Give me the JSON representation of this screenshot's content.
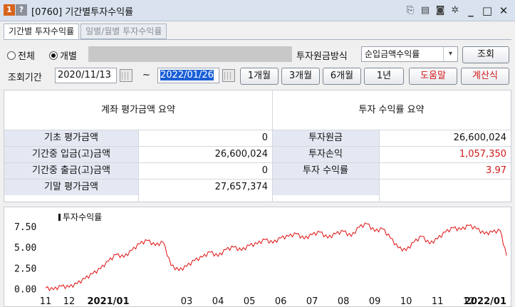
{
  "window": {
    "title": "[0760] 기간별투자수익률",
    "badge_num": "1",
    "badge_q": "?"
  },
  "tabs": [
    {
      "label": "기간별 투자수익률",
      "active": true
    },
    {
      "label": "일별/월별 투자수익률",
      "active": false
    }
  ],
  "filter": {
    "radio_all": "전체",
    "radio_individual": "개별",
    "selected": "개별",
    "method_label": "투자원금방식",
    "method_value": "순입금액수익률",
    "query_button": "조회",
    "period_label": "조회기간",
    "start_date": "2020/11/13",
    "tilde": "~",
    "end_date": "2022/01/26",
    "quick_buttons": [
      "1개월",
      "3개월",
      "6개월",
      "1년"
    ],
    "help_button": "도움말",
    "calc_button": "계산식"
  },
  "summary": {
    "left_title": "계좌 평가금액 요약",
    "right_title": "투자 수익률 요약",
    "left_rows": [
      {
        "label": "기초 평가금액",
        "value": "0"
      },
      {
        "label": "기간중 입금(고)금액",
        "value": "26,600,024"
      },
      {
        "label": "기간중 출금(고)금액",
        "value": "0"
      },
      {
        "label": "기말 평가금액",
        "value": "27,657,374"
      }
    ],
    "right_rows": [
      {
        "label": "투자원금",
        "value": "26,600,024",
        "red": false
      },
      {
        "label": "투자손익",
        "value": "1,057,350",
        "red": true
      },
      {
        "label": "투자 수익률",
        "value": "3.97",
        "red": true
      },
      {
        "label": "",
        "value": "",
        "red": false
      }
    ]
  },
  "chart_data": {
    "type": "line",
    "legend": "투자수익률",
    "line_color": "#e01010",
    "ylim": [
      -0.3,
      8.6
    ],
    "yticks": [
      "7.50",
      "5.00",
      "2.50",
      "0.00"
    ],
    "ytick_values": [
      7.5,
      5.0,
      2.5,
      0.0
    ],
    "xtick_labels": [
      "11",
      "12",
      "2021/01",
      "03",
      "04",
      "05",
      "06",
      "07",
      "08",
      "09",
      "10",
      "11",
      "12",
      "2022/01"
    ],
    "xtick_bold": [
      false,
      false,
      true,
      false,
      false,
      false,
      false,
      false,
      false,
      false,
      false,
      false,
      false,
      true
    ],
    "x_range": [
      0,
      294
    ],
    "xtick_positions": [
      0,
      15,
      40,
      90,
      110,
      130,
      150,
      170,
      190,
      210,
      230,
      250,
      270,
      294
    ],
    "x": [
      0,
      5,
      10,
      15,
      20,
      25,
      30,
      35,
      40,
      45,
      50,
      55,
      60,
      65,
      70,
      75,
      80,
      85,
      90,
      95,
      100,
      105,
      110,
      115,
      120,
      125,
      130,
      135,
      140,
      145,
      150,
      155,
      160,
      165,
      170,
      175,
      180,
      185,
      190,
      195,
      200,
      205,
      210,
      215,
      220,
      225,
      230,
      235,
      240,
      245,
      250,
      255,
      260,
      265,
      270,
      275,
      280,
      285,
      290,
      294
    ],
    "y": [
      0.1,
      -0.1,
      0.3,
      0.2,
      0.6,
      1.2,
      1.8,
      2.4,
      3.3,
      4.1,
      3.8,
      4.6,
      5.4,
      5.8,
      5.2,
      5.6,
      2.8,
      2.2,
      2.7,
      3.4,
      3.8,
      4.4,
      3.9,
      4.7,
      5.0,
      4.6,
      5.2,
      5.4,
      5.9,
      5.5,
      6.1,
      6.3,
      6.6,
      6.0,
      6.5,
      6.8,
      6.1,
      6.6,
      6.9,
      6.3,
      7.4,
      7.8,
      6.9,
      7.2,
      6.1,
      4.9,
      4.6,
      5.6,
      6.3,
      5.4,
      6.0,
      6.8,
      7.3,
      7.1,
      7.6,
      7.2,
      6.6,
      6.8,
      7.0,
      4.0
    ]
  }
}
